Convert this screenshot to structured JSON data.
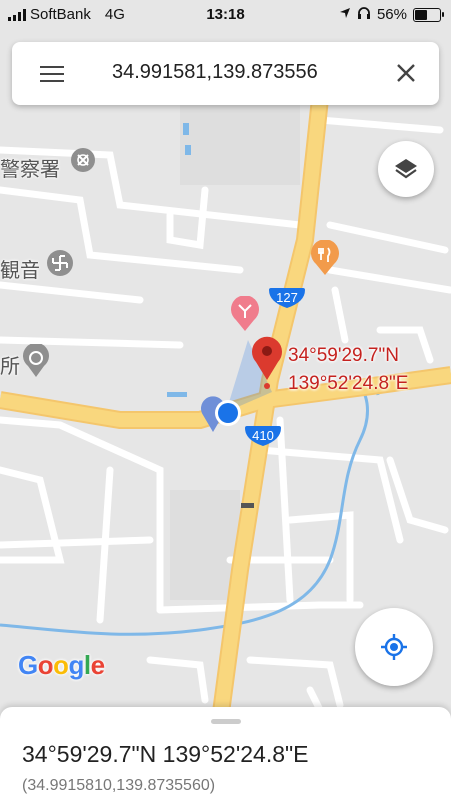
{
  "status_bar": {
    "carrier": "SoftBank",
    "network": "4G",
    "time": "13:18",
    "battery": "56%",
    "battery_level": 0.56
  },
  "search": {
    "query": "34.991581,139.873556",
    "menu_icon": "hamburger-menu-icon",
    "close_icon": "close-icon"
  },
  "map": {
    "labels": {
      "police": "警察署",
      "kannon": "観音",
      "place": "所"
    },
    "road_badges": [
      "127",
      "410"
    ],
    "pin_label_lat": "34°59'29.7\"N",
    "pin_label_lng": "139°52'24.8\"E",
    "logo": "Google",
    "colors": {
      "pin": "#db3a2e",
      "my_location": "#1a73e8",
      "road_major": "#f9d77e",
      "water": "#7fb8e8",
      "background": "#e6e6e6",
      "badge": "#1a73e8"
    }
  },
  "controls": {
    "layers_icon": "layers-icon",
    "locate_icon": "my-location-icon"
  },
  "bottom_sheet": {
    "dms": "34°59'29.7\"N 139°52'24.8\"E",
    "decimal": "(34.9915810,139.8735560)"
  }
}
